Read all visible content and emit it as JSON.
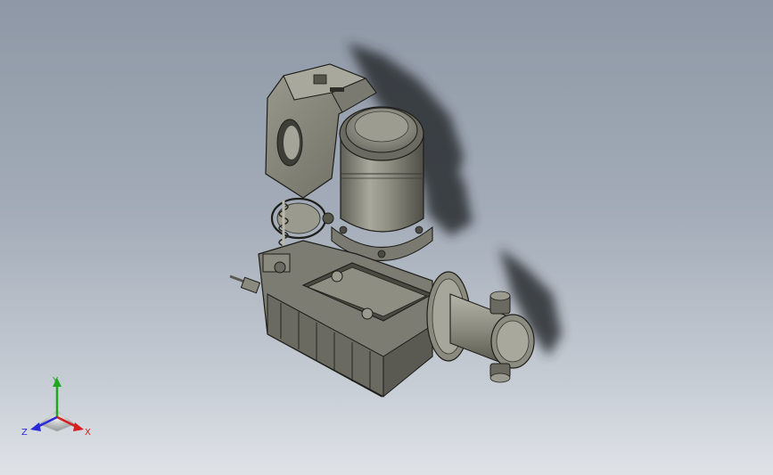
{
  "viewport": {
    "background_top": "#8e98a6",
    "background_bottom": "#dfe3e8"
  },
  "model": {
    "body_color": "#8a8a7e",
    "edge_color": "#1e1e1a",
    "shadow_color": "#2a2d33"
  },
  "triad": {
    "x_label": "X",
    "y_label": "Y",
    "z_label": "Z",
    "x_color": "#d42020",
    "y_color": "#1fa81f",
    "z_color": "#2a2ad8"
  }
}
